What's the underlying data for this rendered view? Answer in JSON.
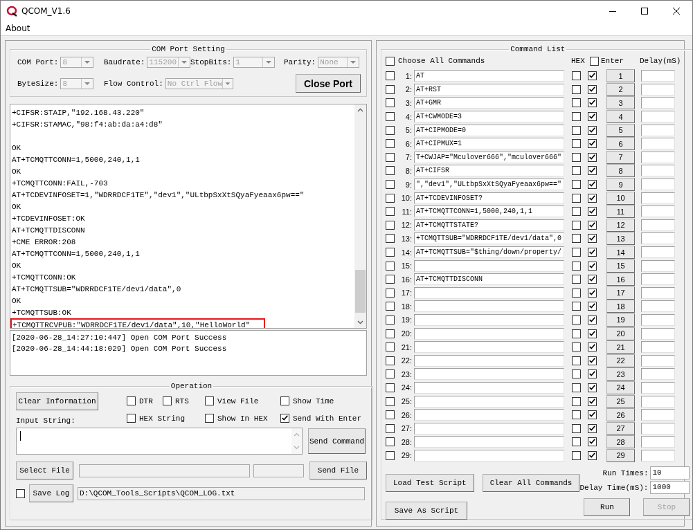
{
  "window": {
    "title": "QCOM_V1.6",
    "menu": [
      "About"
    ]
  },
  "com_port_setting": {
    "title": "COM Port Setting",
    "fields": [
      {
        "label": "COM Port:",
        "value": "8",
        "disabled": true
      },
      {
        "label": "Baudrate:",
        "value": "115200",
        "disabled": true
      },
      {
        "label": "StopBits:",
        "value": "1",
        "disabled": true
      },
      {
        "label": "Parity:",
        "value": "None",
        "disabled": true
      },
      {
        "label": "ByteSize:",
        "value": "8",
        "disabled": true
      },
      {
        "label": "Flow Control:",
        "value": "No Ctrl Flow",
        "disabled": true
      }
    ],
    "close_port_button": "Close Port"
  },
  "receive_log": {
    "lines": [
      {
        "text": "+CIFSR:STAIP,\"192.168.43.220\"",
        "gap_before": false,
        "highlighted": false
      },
      {
        "text": "+CIFSR:STAMAC,\"98:f4:ab:da:a4:d8\"",
        "gap_before": false,
        "highlighted": false
      },
      {
        "text": "OK",
        "gap_before": true,
        "highlighted": false
      },
      {
        "text": "AT+TCMQTTCONN=1,5000,240,1,1",
        "gap_before": false,
        "highlighted": false
      },
      {
        "text": "OK",
        "gap_before": false,
        "highlighted": false
      },
      {
        "text": "+TCMQTTCONN:FAIL,-703",
        "gap_before": false,
        "highlighted": false
      },
      {
        "text": "AT+TCDEVINFOSET=1,\"WDRRDCF1TE\",\"dev1\",\"ULtbpSxXtSQyaFyeaax6pw==\"",
        "gap_before": false,
        "highlighted": false
      },
      {
        "text": "OK",
        "gap_before": false,
        "highlighted": false
      },
      {
        "text": "+TCDEVINFOSET:OK",
        "gap_before": false,
        "highlighted": false
      },
      {
        "text": "AT+TCMQTTDISCONN",
        "gap_before": false,
        "highlighted": false
      },
      {
        "text": "+CME ERROR:208",
        "gap_before": false,
        "highlighted": false
      },
      {
        "text": "AT+TCMQTTCONN=1,5000,240,1,1",
        "gap_before": false,
        "highlighted": false
      },
      {
        "text": "OK",
        "gap_before": false,
        "highlighted": false
      },
      {
        "text": "+TCMQTTCONN:OK",
        "gap_before": false,
        "highlighted": false
      },
      {
        "text": "AT+TCMQTTSUB=\"WDRRDCF1TE/dev1/data\",0",
        "gap_before": false,
        "highlighted": false
      },
      {
        "text": "OK",
        "gap_before": false,
        "highlighted": false
      },
      {
        "text": "+TCMQTTSUB:OK",
        "gap_before": false,
        "highlighted": false
      },
      {
        "text": "+TCMQTTRCVPUB:\"WDRRDCF1TE/dev1/data\",10,\"HelloWorld\"",
        "gap_before": false,
        "highlighted": true
      }
    ]
  },
  "status_log": [
    "[2020-06-28_14:27:10:447] Open COM Port Success",
    "[2020-06-28_14:44:18:029] Open COM Port Success"
  ],
  "operation": {
    "title": "Operation",
    "clear_button": "Clear Information",
    "options": [
      {
        "label": "DTR",
        "checked": false
      },
      {
        "label": "RTS",
        "checked": false
      },
      {
        "label": "View File",
        "checked": false
      },
      {
        "label": "Show Time",
        "checked": false
      },
      {
        "label": "HEX String",
        "checked": false
      },
      {
        "label": "Show In HEX",
        "checked": false
      },
      {
        "label": "Send With Enter",
        "checked": true
      }
    ],
    "input_label": "Input String:",
    "send_command_button": "Send Command",
    "select_file_button": "Select File",
    "send_file_button": "Send File",
    "save_log": {
      "checked": false,
      "label": "Save Log"
    },
    "log_path": "D:\\QCOM_Tools_Scripts\\QCOM_LOG.txt"
  },
  "command_list": {
    "title": "Command List",
    "choose_all": {
      "label": "Choose All Commands",
      "checked": false
    },
    "hex_header": "HEX",
    "enter_header": {
      "label": "Enter",
      "checked": false
    },
    "delay_header": "Delay(mS)",
    "rows": [
      {
        "number": "1:",
        "selected": false,
        "command": "AT",
        "hex": false,
        "enter": true,
        "button": "1"
      },
      {
        "number": "2:",
        "selected": false,
        "command": "AT+RST",
        "hex": false,
        "enter": true,
        "button": "2"
      },
      {
        "number": "3:",
        "selected": false,
        "command": "AT+GMR",
        "hex": false,
        "enter": true,
        "button": "3"
      },
      {
        "number": "4:",
        "selected": false,
        "command": "AT+CWMODE=3",
        "hex": false,
        "enter": true,
        "button": "4"
      },
      {
        "number": "5:",
        "selected": false,
        "command": "AT+CIPMODE=0",
        "hex": false,
        "enter": true,
        "button": "5"
      },
      {
        "number": "6:",
        "selected": false,
        "command": "AT+CIPMUX=1",
        "hex": false,
        "enter": true,
        "button": "6"
      },
      {
        "number": "7:",
        "selected": false,
        "command": "T+CWJAP=\"Mculover666\",\"mculover666\"",
        "hex": false,
        "enter": true,
        "button": "7"
      },
      {
        "number": "8:",
        "selected": false,
        "command": "AT+CIFSR",
        "hex": false,
        "enter": true,
        "button": "8"
      },
      {
        "number": "9:",
        "selected": false,
        "command": "\",\"dev1\",\"ULtbpSxXtSQyaFyeaax6pw==\"",
        "hex": false,
        "enter": true,
        "button": "9"
      },
      {
        "number": "10:",
        "selected": false,
        "command": "AT+TCDEVINFOSET?",
        "hex": false,
        "enter": true,
        "button": "10"
      },
      {
        "number": "11:",
        "selected": false,
        "command": "AT+TCMQTTCONN=1,5000,240,1,1",
        "hex": false,
        "enter": true,
        "button": "11"
      },
      {
        "number": "12:",
        "selected": false,
        "command": "AT+TCMQTTSTATE?",
        "hex": false,
        "enter": true,
        "button": "12"
      },
      {
        "number": "13:",
        "selected": false,
        "command": "+TCMQTTSUB=\"WDRRDCF1TE/dev1/data\",0",
        "hex": false,
        "enter": true,
        "button": "13"
      },
      {
        "number": "14:",
        "selected": false,
        "command": "AT+TCMQTTSUB=\"$thing/down/property/",
        "hex": false,
        "enter": true,
        "button": "14"
      },
      {
        "number": "15:",
        "selected": false,
        "hex": false,
        "enter": true,
        "button": "15"
      },
      {
        "number": "16:",
        "selected": false,
        "command": "AT+TCMQTTDISCONN",
        "hex": false,
        "enter": true,
        "button": "16"
      },
      {
        "number": "17:",
        "selected": false,
        "hex": false,
        "enter": true,
        "button": "17"
      },
      {
        "number": "18:",
        "selected": false,
        "hex": false,
        "enter": true,
        "button": "18"
      },
      {
        "number": "19:",
        "selected": false,
        "hex": false,
        "enter": true,
        "button": "19"
      },
      {
        "number": "20:",
        "selected": false,
        "hex": false,
        "enter": true,
        "button": "20"
      },
      {
        "number": "21:",
        "selected": false,
        "hex": false,
        "enter": true,
        "button": "21"
      },
      {
        "number": "22:",
        "selected": false,
        "hex": false,
        "enter": true,
        "button": "22"
      },
      {
        "number": "23:",
        "selected": false,
        "hex": false,
        "enter": true,
        "button": "23"
      },
      {
        "number": "24:",
        "selected": false,
        "hex": false,
        "enter": true,
        "button": "24"
      },
      {
        "number": "25:",
        "selected": false,
        "hex": false,
        "enter": true,
        "button": "25"
      },
      {
        "number": "26:",
        "selected": false,
        "hex": false,
        "enter": true,
        "button": "26"
      },
      {
        "number": "27:",
        "selected": false,
        "hex": false,
        "enter": true,
        "button": "27"
      },
      {
        "number": "28:",
        "selected": false,
        "hex": false,
        "enter": true,
        "button": "28"
      },
      {
        "number": "29:",
        "selected": false,
        "hex": false,
        "enter": true,
        "button": "29"
      }
    ],
    "load_button": "Load Test Script",
    "clear_button": "Clear All Commands",
    "save_button": "Save As Script",
    "run_times_label": "Run Times:",
    "run_times": "10",
    "delay_time_label": "Delay Time(mS):",
    "delay_time": "1000",
    "run_button": "Run",
    "stop_button": {
      "label": "Stop",
      "disabled": true
    }
  }
}
